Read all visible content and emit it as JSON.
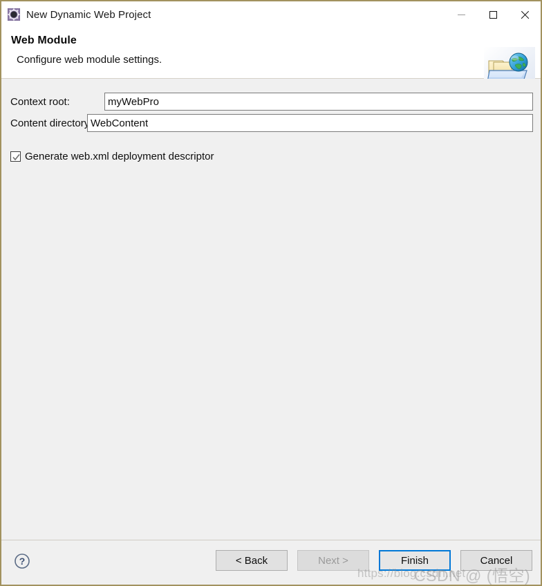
{
  "window": {
    "title": "New Dynamic Web Project",
    "icon": "wizard-gear-icon",
    "minimize_label": "Minimize",
    "maximize_label": "Maximize",
    "close_label": "Close"
  },
  "header": {
    "title": "Web Module",
    "description": "Configure web module settings.",
    "icon": "web-project-folder-globe-icon"
  },
  "form": {
    "context_root": {
      "label": "Context root:",
      "value": "myWebPro",
      "placeholder": ""
    },
    "content_directory": {
      "label": "Content directory:",
      "value": "WebContent",
      "placeholder": ""
    },
    "generate_webxml": {
      "label": "Generate web.xml deployment descriptor",
      "checked": true
    }
  },
  "footer": {
    "help_icon": "help-question-icon",
    "buttons": [
      {
        "label": "< Back",
        "state": "enabled"
      },
      {
        "label": "Next >",
        "state": "disabled"
      },
      {
        "label": "Finish",
        "state": "default"
      },
      {
        "label": "Cancel",
        "state": "enabled"
      }
    ]
  },
  "watermark": {
    "url": "https://blog.csdn.net",
    "brand": "CSDN @ (悟空)"
  },
  "colors": {
    "dialog_border": "#a2925e",
    "body_background": "#f0f0f0",
    "accent_default_button": "#0078d7",
    "title_icon_purple": "#8d7ba8"
  }
}
